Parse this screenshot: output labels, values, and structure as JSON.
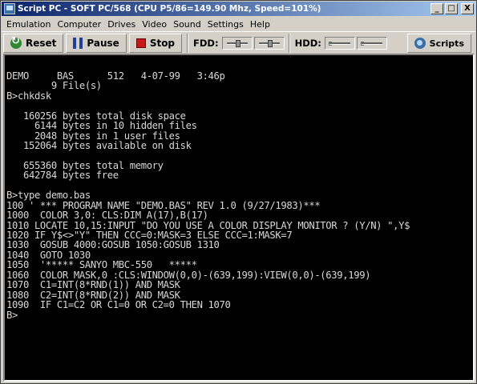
{
  "window": {
    "title": "Script PC - SOFT PC/568  (CPU P5/86=149.90 Mhz, Speed=101%)",
    "buttons": [
      "_",
      "□",
      "X"
    ]
  },
  "menu": [
    "Emulation",
    "Computer",
    "Drives",
    "Video",
    "Sound",
    "Settings",
    "Help"
  ],
  "toolbar": {
    "reset_label": "Reset",
    "pause_label": "Pause",
    "stop_label": "Stop",
    "fdd_label": "FDD:",
    "hdd_label": "HDD:",
    "scripts_label": "Scripts"
  },
  "terminal": {
    "lines": [
      "DEMO     BAS      512   4-07-99   3:46p",
      "        9 File(s)",
      "B>chkdsk",
      "",
      "   160256 bytes total disk space",
      "     6144 bytes in 10 hidden files",
      "     2048 bytes in 1 user files",
      "   152064 bytes available on disk",
      "",
      "   655360 bytes total memory",
      "   642784 bytes free",
      "",
      "B>type demo.bas",
      "100 ' *** PROGRAM NAME \"DEMO.BAS\" REV 1.0 (9/27/1983)***",
      "1000  COLOR 3,0: CLS:DIM A(17),B(17)",
      "1010 LOCATE 10,15:INPUT \"DO YOU USE A COLOR DISPLAY MONITOR ? (Y/N) \",Y$",
      "1020 IF Y$<>\"Y\" THEN CCC=0:MASK=3 ELSE CCC=1:MASK=7",
      "1030  GOSUB 4000:GOSUB 1050:GOSUB 1310",
      "1040  GOTO 1030",
      "1050  '***** SANYO MBC-550   *****",
      "1060  COLOR MASK,0 :CLS:WINDOW(0,0)-(639,199):VIEW(0,0)-(639,199)",
      "1070  C1=INT(8*RND(1)) AND MASK",
      "1080  C2=INT(8*RND(2)) AND MASK",
      "1090  IF C1=C2 OR C1=0 OR C2=0 THEN 1070",
      "B>"
    ]
  }
}
